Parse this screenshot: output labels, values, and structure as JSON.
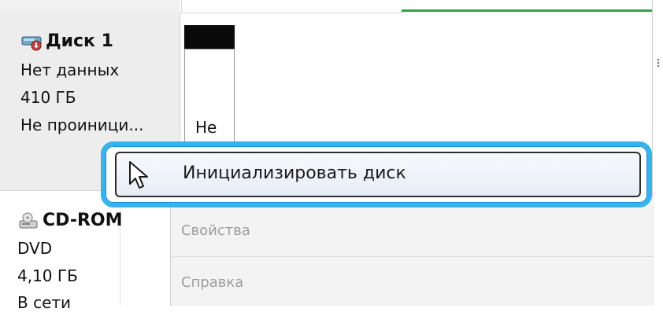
{
  "disk": {
    "title": "Диск 1",
    "line1": "Нет данных",
    "line2": "410 ГБ",
    "line3": "Не проиници...",
    "volume_label": "Не"
  },
  "cdrom": {
    "title": "CD-ROM",
    "line1": "DVD",
    "line2": "4,10 ГБ",
    "line3": "В сети"
  },
  "context_menu": {
    "items": [
      {
        "label": "Инициализировать диск",
        "state": "hovered"
      },
      {
        "label": "Свойства",
        "state": "disabled"
      },
      {
        "label": "Справка",
        "state": "disabled"
      }
    ]
  },
  "colors": {
    "highlight": "#36b3ec",
    "progress_green": "#2ea44f",
    "volume_black": "#0a0a0a"
  },
  "icons": {
    "disk": "disk-icon",
    "cdrom": "cdrom-icon",
    "cursor": "mouse-cursor-icon"
  }
}
